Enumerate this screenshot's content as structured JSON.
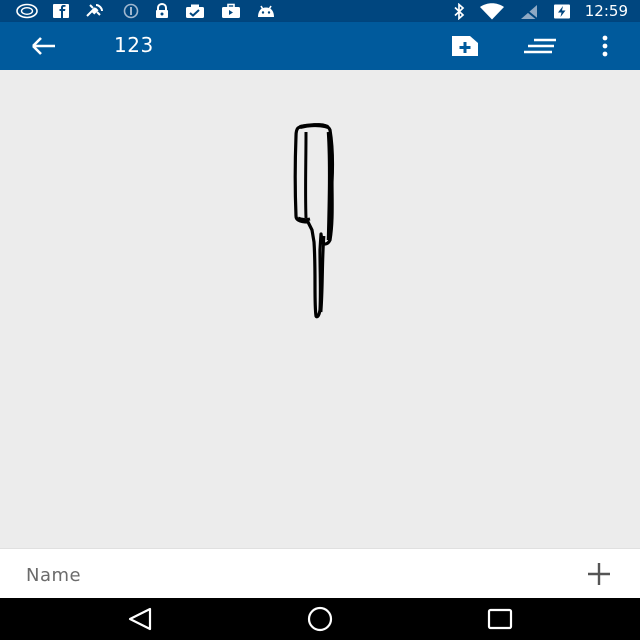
{
  "status_bar": {
    "time": "12:59",
    "icons_left": [
      "compass-icon",
      "facebook-icon",
      "satellite-icon",
      "sync-icon",
      "lock-icon",
      "photo-check-icon",
      "briefcase-icon",
      "android-icon"
    ],
    "icons_right": [
      "bluetooth-icon",
      "wifi-icon",
      "signal-off-icon",
      "battery-charging-icon"
    ]
  },
  "app_bar": {
    "title": "123",
    "actions": [
      "add-document-icon",
      "sort-lines-icon",
      "more-vert-icon"
    ]
  },
  "name_bar": {
    "placeholder": "Name"
  },
  "colors": {
    "status_bar": "#00467f",
    "app_bar": "#005a9c",
    "canvas": "#ececec"
  }
}
